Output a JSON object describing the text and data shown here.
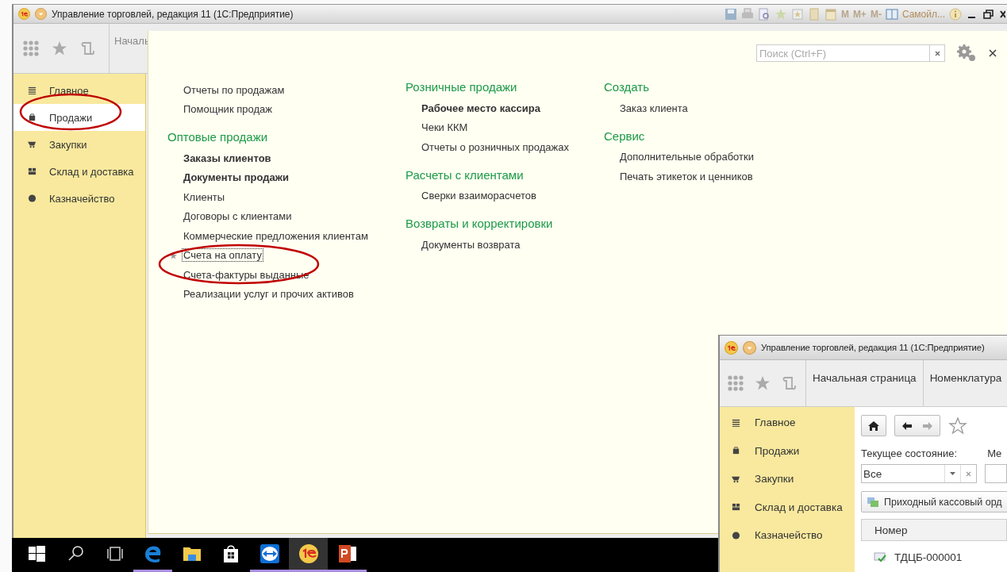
{
  "window": {
    "title": "Управление торговлей, редакция 11  (1С:Предприятие)",
    "memory_buttons": [
      "M",
      "M+",
      "M-"
    ],
    "user": "Самойл...",
    "tab": "Началь"
  },
  "sidebar": {
    "items": [
      {
        "label": "Главное",
        "kind": "main",
        "selected": false
      },
      {
        "label": "Продажи",
        "kind": "sales",
        "selected": true
      },
      {
        "label": "Закупки",
        "kind": "purchases",
        "selected": false
      },
      {
        "label": "Склад и доставка",
        "kind": "warehouse",
        "selected": false
      },
      {
        "label": "Казначейство",
        "kind": "treasury",
        "selected": false
      }
    ]
  },
  "panel": {
    "search": {
      "placeholder": "Поиск (Ctrl+F)"
    },
    "columns": [
      {
        "sections": [
          {
            "items": [
              {
                "label": "Отчеты по продажам",
                "bold": false,
                "favorite": false,
                "focused": false
              },
              {
                "label": "Помощник продаж",
                "bold": false,
                "favorite": false,
                "focused": false
              }
            ]
          },
          {
            "title": "Оптовые продажи",
            "items": [
              {
                "label": "Заказы клиентов",
                "bold": true,
                "favorite": false,
                "focused": false
              },
              {
                "label": "Документы продажи",
                "bold": true,
                "favorite": false,
                "focused": false
              },
              {
                "label": "Клиенты",
                "bold": false,
                "favorite": false,
                "focused": false
              },
              {
                "label": "Договоры с клиентами",
                "bold": false,
                "favorite": false,
                "focused": false
              },
              {
                "label": "Коммерческие предложения клиентам",
                "bold": false,
                "favorite": false,
                "focused": false
              },
              {
                "label": "Счета на оплату",
                "bold": false,
                "favorite": true,
                "focused": true
              },
              {
                "label": "Счета-фактуры выданные",
                "bold": false,
                "favorite": false,
                "focused": false
              },
              {
                "label": "Реализации услуг и прочих активов",
                "bold": false,
                "favorite": false,
                "focused": false
              }
            ]
          }
        ]
      },
      {
        "sections": [
          {
            "title": "Розничные продажи",
            "items": [
              {
                "label": "Рабочее место кассира",
                "bold": true,
                "favorite": false,
                "focused": false
              },
              {
                "label": "Чеки ККМ",
                "bold": false,
                "favorite": false,
                "focused": false
              },
              {
                "label": "Отчеты о розничных продажах",
                "bold": false,
                "favorite": false,
                "focused": false
              }
            ]
          },
          {
            "title": "Расчеты с клиентами",
            "items": [
              {
                "label": "Сверки взаиморасчетов",
                "bold": false,
                "favorite": false,
                "focused": false
              }
            ]
          },
          {
            "title": "Возвраты и корректировки",
            "items": [
              {
                "label": "Документы возврата",
                "bold": false,
                "favorite": false,
                "focused": false
              }
            ]
          }
        ]
      },
      {
        "sections": [
          {
            "title": "Создать",
            "items": [
              {
                "label": "Заказ клиента",
                "bold": false,
                "favorite": false,
                "focused": false
              }
            ]
          },
          {
            "title": "Сервис",
            "items": [
              {
                "label": "Дополнительные обработки",
                "bold": false,
                "favorite": false,
                "focused": false
              },
              {
                "label": "Печать этикеток и ценников",
                "bold": false,
                "favorite": false,
                "focused": false
              }
            ]
          }
        ]
      }
    ]
  },
  "taskbar": {
    "apps": [
      {
        "kind": "start",
        "running": false,
        "selected": false
      },
      {
        "kind": "search",
        "running": false,
        "selected": false
      },
      {
        "kind": "task-view",
        "running": false,
        "selected": false
      },
      {
        "kind": "browser",
        "running": true,
        "selected": false
      },
      {
        "kind": "folder",
        "running": false,
        "selected": false
      },
      {
        "kind": "store",
        "running": false,
        "selected": false
      },
      {
        "kind": "remote",
        "running": true,
        "selected": false
      },
      {
        "kind": "onec",
        "running": true,
        "selected": true
      },
      {
        "kind": "slides",
        "running": true,
        "selected": false
      }
    ]
  },
  "second_window": {
    "title": "Управление торговлей, редакция 11  (1С:Предприятие)",
    "tabs": [
      "Начальная страница",
      "Номенклатура"
    ],
    "sidebar": {
      "items": [
        {
          "label": "Главное",
          "kind": "main"
        },
        {
          "label": "Продажи",
          "kind": "sales"
        },
        {
          "label": "Закупки",
          "kind": "purchases"
        },
        {
          "label": "Склад и доставка",
          "kind": "warehouse"
        },
        {
          "label": "Казначейство",
          "kind": "treasury"
        }
      ]
    },
    "state_label": "Текущее состояние:",
    "column_2_label": "Ме",
    "state_value": "Все",
    "command": "Приходный кассовый орд",
    "table": {
      "columns": [
        "Номер"
      ],
      "rows": [
        {
          "number": "ТДЦБ-000001"
        }
      ]
    }
  }
}
